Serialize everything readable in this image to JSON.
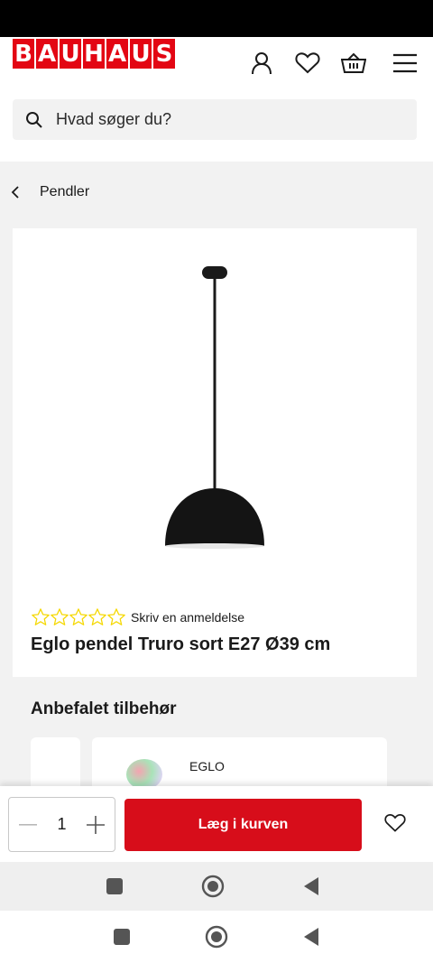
{
  "header": {
    "logo_letters": [
      "B",
      "A",
      "U",
      "H",
      "A",
      "U",
      "S"
    ],
    "logo_text": "BAUHAUS",
    "brand_color": "#e30613",
    "icons": [
      "account-icon",
      "heart-icon",
      "basket-icon",
      "menu-icon"
    ]
  },
  "search": {
    "placeholder": "Hvad søger du?"
  },
  "breadcrumb": {
    "label": "Pendler"
  },
  "product": {
    "rating_stars": 5,
    "rating_value": 0,
    "star_color": "#f5d800",
    "review_link": "Skriv en anmeldelse",
    "title": "Eglo pendel Truro sort E27 Ø39 cm"
  },
  "accessories": {
    "heading": "Anbefalet tilbehør",
    "items": [
      {
        "brand": "EGLO"
      }
    ]
  },
  "cart": {
    "quantity": "1",
    "add_label": "Læg i kurven",
    "button_color": "#d70d1a"
  },
  "system_nav": {
    "buttons": [
      "recents-icon",
      "home-icon",
      "back-icon"
    ]
  }
}
